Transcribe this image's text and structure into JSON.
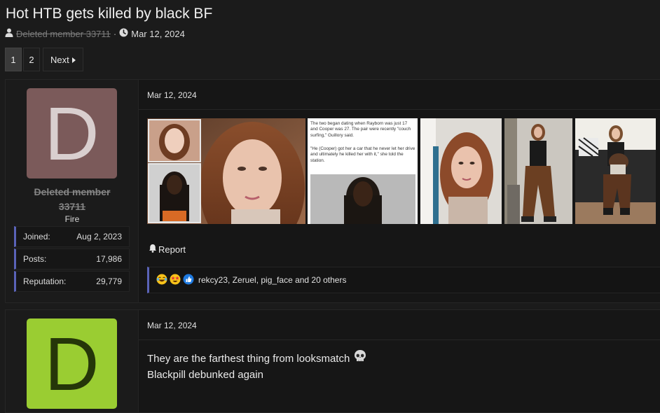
{
  "thread": {
    "title": "Hot HTB gets killed by black BF",
    "author": "Deleted member 33711",
    "separator": "·",
    "date": "Mar 12, 2024"
  },
  "pagination": {
    "pages": [
      "1",
      "2"
    ],
    "current": "1",
    "next_label": "Next"
  },
  "posts": [
    {
      "avatar_letter": "D",
      "avatar_color": "#7b5a5a",
      "username_line1": "Deleted member",
      "username_line2": "33711",
      "user_title": "Fire",
      "stats": [
        {
          "label": "Joined:",
          "value": "Aug 2, 2023"
        },
        {
          "label": "Posts:",
          "value": "17,986"
        },
        {
          "label": "Reputation:",
          "value": "29,779"
        }
      ],
      "date": "Mar 12, 2024",
      "news_caption": "The two began dating when Rayborn was just 17 and Cooper was 27. The pair were recently \"couch surfing,\" Guillory said.",
      "news_quote": "\"He (Cooper) got her a car that he never let her drive and ultimately he killed her with it,\" she told the station.",
      "report_label": "Report",
      "reactions_text": "rekcy23, Zeruel, pig_face and 20 others"
    },
    {
      "avatar_letter": "D",
      "avatar_color": "#9acd32",
      "date": "Mar 12, 2024",
      "message_line1": "They are the farthest thing from looksmatch",
      "message_line2": "Blackpill debunked again"
    }
  ],
  "colors": {
    "accent": "#5a63b8",
    "background": "#1b1b1b"
  },
  "icons": [
    "user-icon",
    "clock-icon",
    "caret-right-icon",
    "bell-icon",
    "laugh-emoji-icon",
    "star-eyes-emoji-icon",
    "like-icon",
    "skull-emoji-icon"
  ]
}
